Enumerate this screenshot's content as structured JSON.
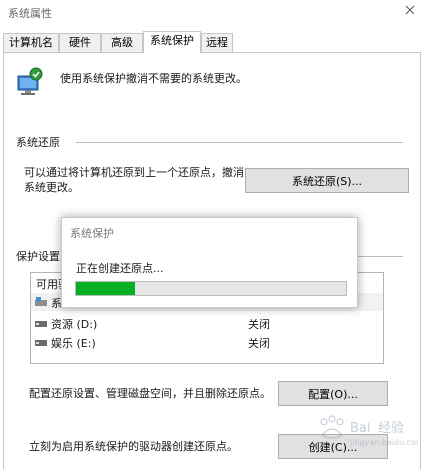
{
  "window": {
    "title": "系统属性"
  },
  "tabs": [
    {
      "label": "计算机名",
      "active": false
    },
    {
      "label": "硬件",
      "active": false
    },
    {
      "label": "高级",
      "active": false
    },
    {
      "label": "系统保护",
      "active": true
    },
    {
      "label": "远程",
      "active": false
    }
  ],
  "intro": {
    "text": "使用系统保护撤消不需要的系统更改。"
  },
  "restore_section": {
    "heading": "系统还原",
    "description": "可以通过将计算机还原到上一个还原点，撤消系统更改。",
    "button_label": "系统还原(S)..."
  },
  "protection_section": {
    "heading": "保护设置",
    "column_drive": "可用驱",
    "drives": [
      {
        "name": "系",
        "status": ""
      },
      {
        "name": "资源 (D:)",
        "status": "关闭"
      },
      {
        "name": "娱乐 (E:)",
        "status": "关闭"
      }
    ]
  },
  "config": {
    "text": "配置还原设置、管理磁盘空间，并且删除还原点。",
    "button_label": "配置(O)..."
  },
  "create": {
    "text": "立刻为启用系统保护的驱动器创建还原点。",
    "button_label": "创建(C)..."
  },
  "progress_dialog": {
    "title": "系统保护",
    "message": "正在创建还原点...",
    "progress_fraction": 0.22
  },
  "colors": {
    "progress": "#06b025",
    "accent": "#0078d7"
  }
}
